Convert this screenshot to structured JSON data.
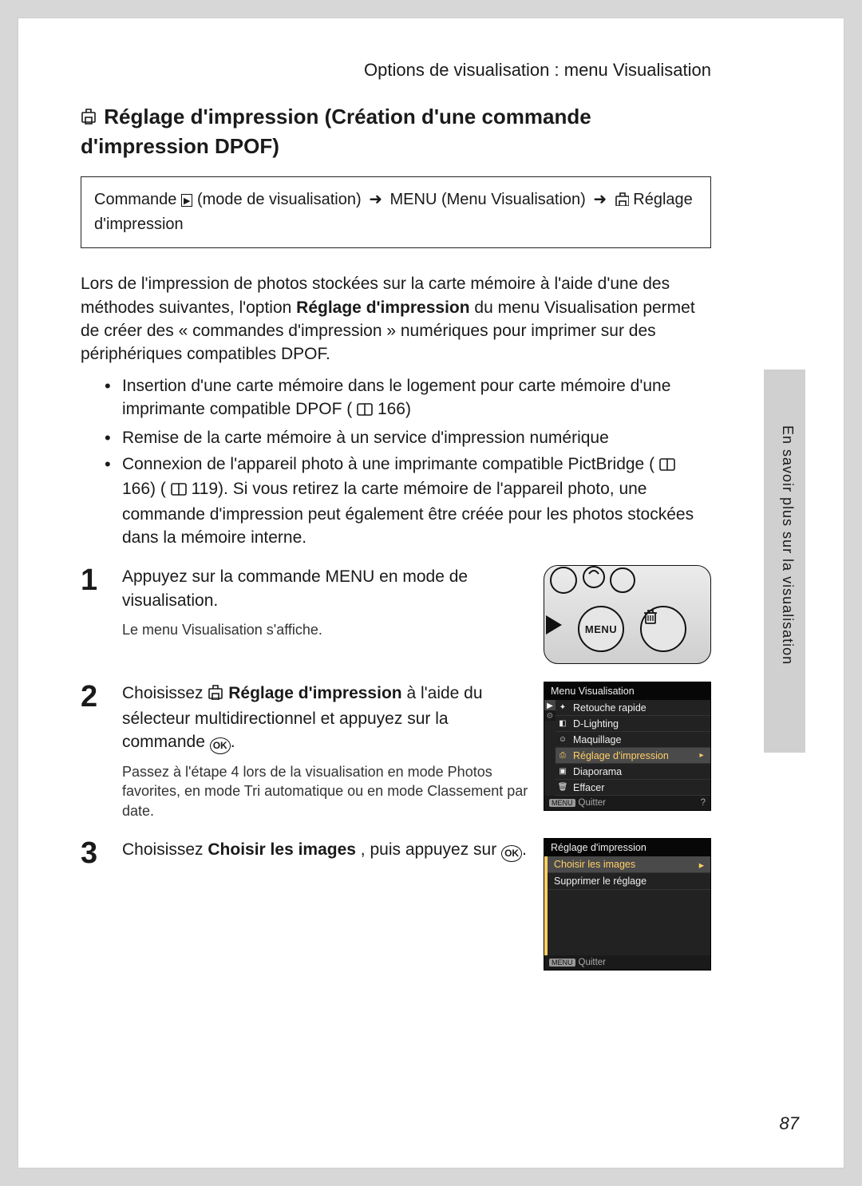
{
  "breadcrumb": "Options de visualisation : menu Visualisation",
  "title": "Réglage d'impression (Création d'une commande d'impression DPOF)",
  "cmd_path": {
    "p1": "Commande ",
    "p2": " (mode de visualisation) ",
    "p3": " MENU (Menu Visualisation) ",
    "p4": "  Réglage d'impression"
  },
  "intro_a": "Lors de l'impression de photos stockées sur la carte mémoire à l'aide d'une des méthodes suivantes, l'option ",
  "intro_bold": "Réglage d'impression",
  "intro_b": " du menu Visualisation permet de créer des « commandes d'impression » numériques pour imprimer sur des périphériques compatibles DPOF.",
  "bullets": {
    "b1a": "Insertion d'une carte mémoire dans le logement pour carte mémoire d'une imprimante compatible DPOF (",
    "b1p": "166",
    "b1b": ")",
    "b2": "Remise de la carte mémoire à un service d'impression numérique",
    "b3a": "Connexion de l'appareil photo à une imprimante compatible PictBridge (",
    "b3p1": "166",
    "b3b": ") (",
    "b3p2": "119",
    "b3c": "). Si vous retirez la carte mémoire de l'appareil photo, une commande d'impression peut également être créée pour les photos stockées dans la mémoire interne."
  },
  "steps": {
    "s1_num": "1",
    "s1_title_a": "Appuyez sur la commande ",
    "s1_title_b": "MENU",
    "s1_title_c": " en mode de visualisation.",
    "s1_sub": "Le menu Visualisation s'affiche.",
    "s1_menu_btn": "MENU",
    "s2_num": "2",
    "s2_title_a": "Choisissez ",
    "s2_title_bold": "Réglage d'impression",
    "s2_title_b": " à l'aide du sélecteur multidirectionnel et appuyez sur la commande ",
    "s2_sub": "Passez à l'étape 4 lors de la visualisation en mode Photos favorites, en mode Tri automatique ou en mode Classement par date.",
    "s3_num": "3",
    "s3_title_a": "Choisissez ",
    "s3_title_bold": "Choisir les images",
    "s3_title_b": ", puis appuyez sur "
  },
  "screen1": {
    "header": "Menu Visualisation",
    "r1": "Retouche rapide",
    "r2": "D-Lighting",
    "r3": "Maquillage",
    "r4": "Réglage d'impression",
    "r5": "Diaporama",
    "r6": "Effacer",
    "footer": "Quitter"
  },
  "screen2": {
    "header": "Réglage d'impression",
    "r1": "Choisir les images",
    "r2": "Supprimer le réglage",
    "footer": "Quitter"
  },
  "side_label": "En savoir plus sur la visualisation",
  "page_num": "87",
  "glyphs": {
    "arrow": "➜",
    "ok": "OK"
  }
}
